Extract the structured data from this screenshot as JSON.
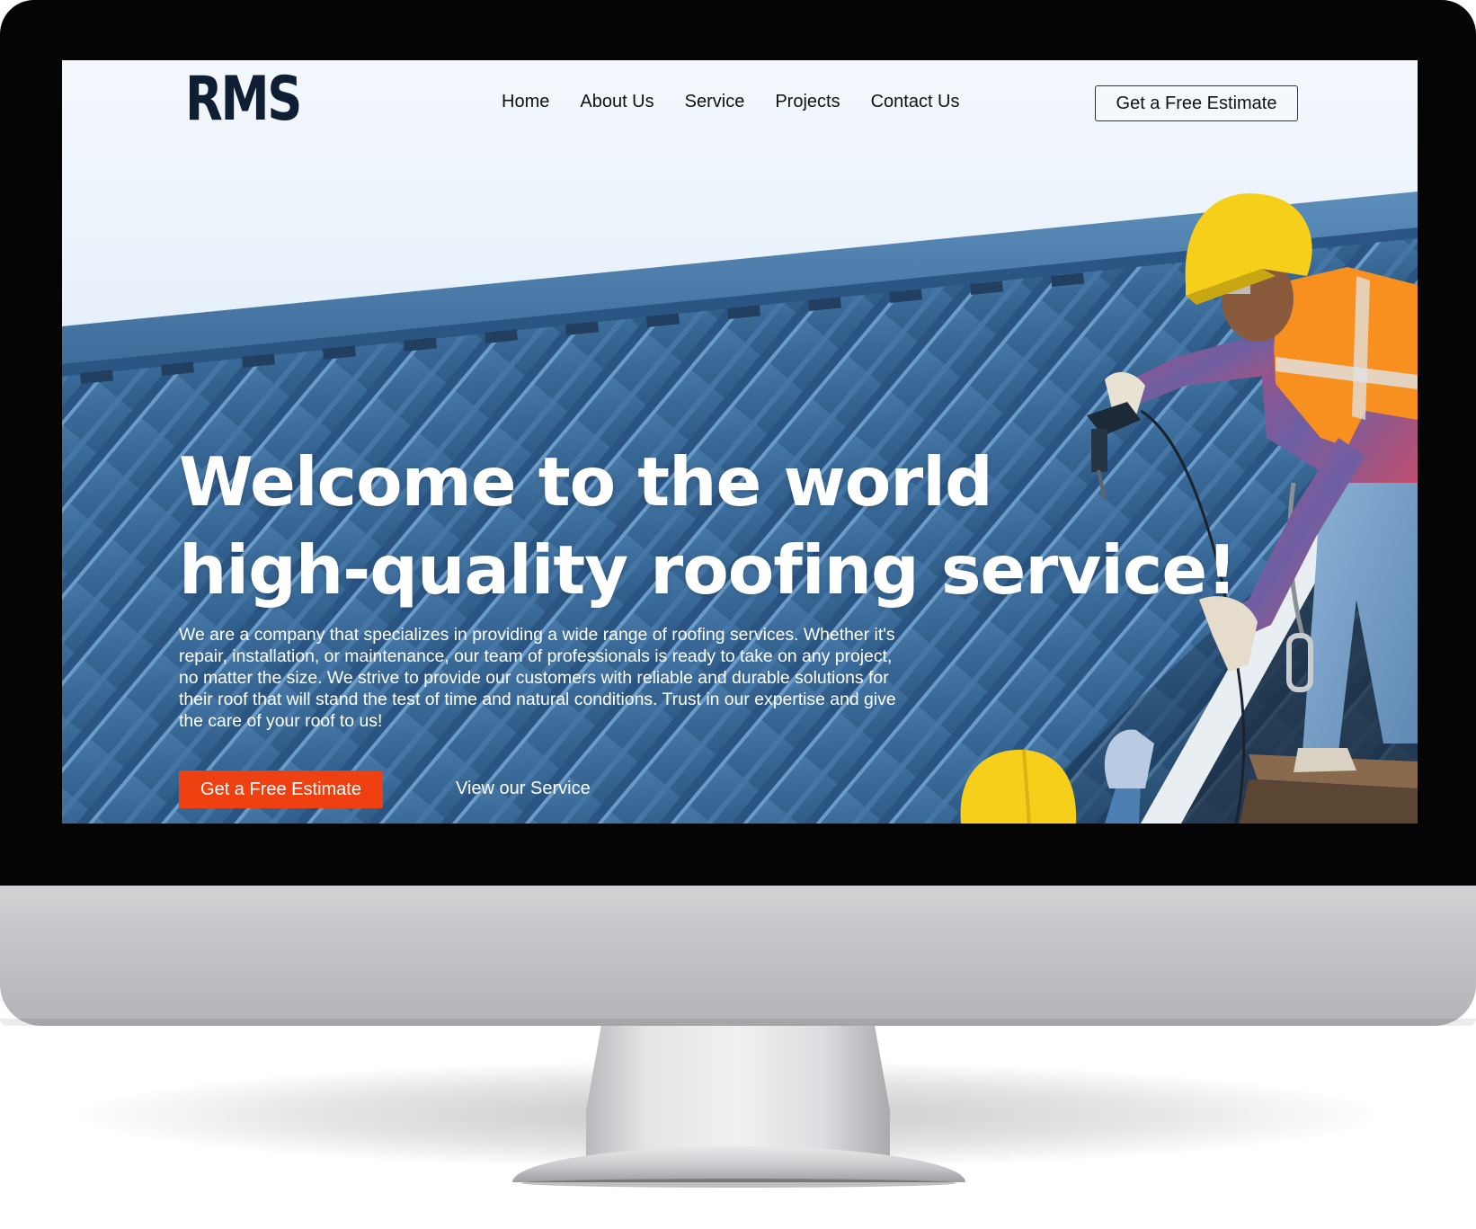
{
  "site": {
    "logo_text": "RMS"
  },
  "nav": {
    "items": [
      {
        "label": "Home"
      },
      {
        "label": "About Us"
      },
      {
        "label": "Service"
      },
      {
        "label": "Projects"
      },
      {
        "label": "Contact Us"
      }
    ],
    "cta_label": "Get a Free Estimate"
  },
  "hero": {
    "title_line1": "Welcome to the world",
    "title_line2": "high-quality roofing service!",
    "description": "We are a company that specializes in providing a wide range of roofing services. Whether it's repair, installation, or maintenance, our team of professionals is ready to take on any project, no matter the size. We strive to provide our customers with reliable and durable solutions for their roof that will stand the test of time and natural conditions. Trust in our expertise and give the care of your roof to us!",
    "primary_button": "Get a Free Estimate",
    "secondary_link": "View our Service"
  },
  "colors": {
    "accent": "#ee4011",
    "logo": "#0f1f33",
    "roof": "#3e6f9e",
    "helmet": "#f5cf1a",
    "vest": "#f7901e"
  },
  "imagery": {
    "background": "metal-roof-with-worker-photo"
  }
}
